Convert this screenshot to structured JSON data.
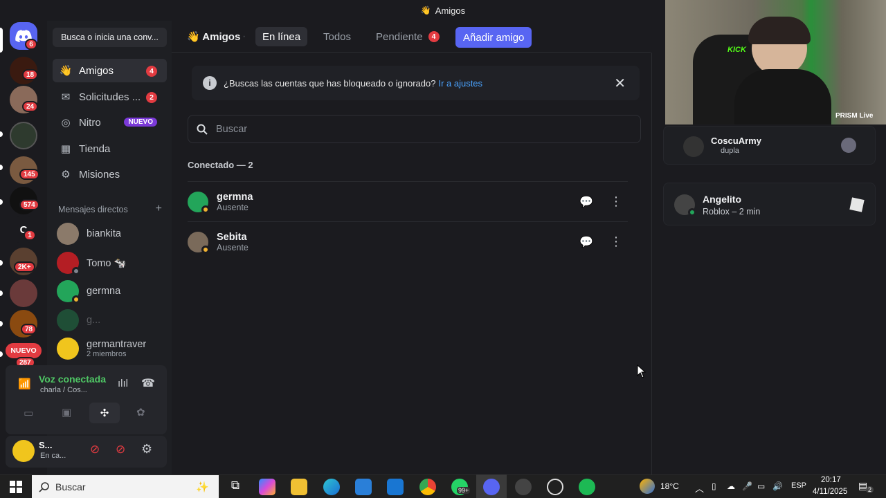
{
  "window": {
    "title": "Amigos"
  },
  "rail": {
    "badges": [
      "6",
      "18",
      "24",
      "145",
      "574",
      "1",
      "2K+",
      "78",
      "287"
    ],
    "home_letter": "C",
    "new_label": "NUEVO"
  },
  "sidebar": {
    "search_label": "Busca o inicia una conv...",
    "nav": [
      {
        "label": "Amigos",
        "count": "4"
      },
      {
        "label": "Solicitudes ...",
        "count": "2"
      },
      {
        "label": "Nitro",
        "tag": "NUEVO"
      },
      {
        "label": "Tienda"
      },
      {
        "label": "Misiones"
      }
    ],
    "dm_header": "Mensajes directos",
    "dm_add": "+",
    "dms": [
      {
        "name": "biankita"
      },
      {
        "name": "Tomo 🐄"
      },
      {
        "name": "germna"
      },
      {
        "name": "g..."
      },
      {
        "name": "germantraver",
        "sub": "2 miembros"
      }
    ]
  },
  "voice": {
    "status": "Voz conectada",
    "channel": "charla / Cos..."
  },
  "user": {
    "name": "S...",
    "status": "En ca..."
  },
  "header": {
    "title": "Amigos",
    "tabs": [
      {
        "label": "En línea"
      },
      {
        "label": "Todos"
      },
      {
        "label": "Pendiente",
        "count": "4"
      }
    ],
    "add_friend": "Añadir amigo"
  },
  "notice": {
    "text": "¿Buscas las cuentas que has bloqueado o ignorado?",
    "link": "Ir a ajustes"
  },
  "search": {
    "placeholder": "Buscar"
  },
  "online": {
    "header": "Conectado — 2",
    "friends": [
      {
        "name": "germna",
        "status": "Ausente"
      },
      {
        "name": "Sebita",
        "status": "Ausente"
      }
    ]
  },
  "activity": {
    "cards": [
      {
        "name": "CoscuArmy",
        "sub": "dupla"
      },
      {
        "name": "Angelito",
        "sub": "Roblox – 2 min"
      }
    ]
  },
  "webcam": {
    "overlay": "PRISM Live",
    "logo": "KICK"
  },
  "taskbar": {
    "search_placeholder": "Buscar",
    "temp": "18°C",
    "lang": "ESP",
    "time": "20:17",
    "date": "4/11/2025",
    "notif": "2",
    "whatsapp_badge": "99+"
  },
  "colors": {
    "accent": "#5865f2",
    "online": "#23a55a",
    "idle": "#f0b232",
    "badge": "#e23b41",
    "nitro": "#7b39d8"
  }
}
